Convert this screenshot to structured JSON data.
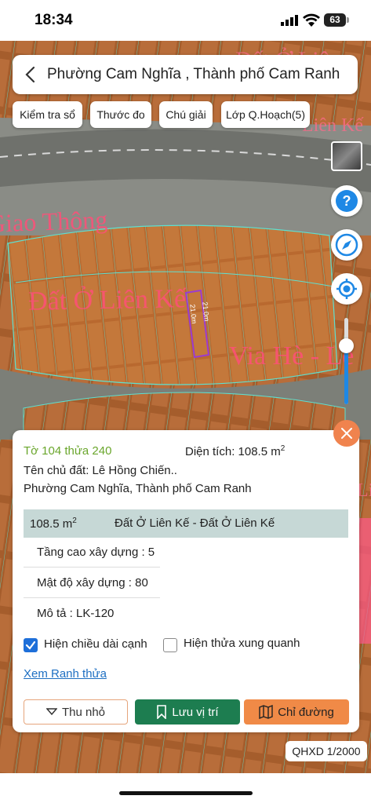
{
  "status": {
    "time": "18:34",
    "battery": "63"
  },
  "header": {
    "location": "Phường Cam Nghĩa , Thành phố Cam Ranh"
  },
  "toolbar": {
    "check_book": "Kiểm tra sổ",
    "ruler": "Thước đo",
    "legend": "Chú giải",
    "planning_layer": "Lớp Q.Hoạch(5)"
  },
  "map": {
    "labels": {
      "traffic": "Giao Thông",
      "residential": "Đất Ở Liên Kế",
      "sidewalk": "Via Hè - Lề",
      "top_repeat": "Đất Ở Liên",
      "chip_repeat": "Liên Kế",
      "edge_repeat": "Liên Kế"
    },
    "dim_long": "21.0m",
    "dim_short": "21.0m",
    "scale": "QHXD 1/2000"
  },
  "panel": {
    "parcel_id": "Tờ 104 thửa 240",
    "area_label": "Diện tích: 108.5 m",
    "area_sup": "2",
    "owner": "Tên chủ đất: Lê Hồng Chiến..",
    "address": "Phường Cam Nghĩa, Thành phố Cam Ranh",
    "zone_area": "108.5 m",
    "zone_area_sup": "2",
    "zone_type": "Đất Ở Liên Kế - Đất Ở Liên Kế",
    "height": "Tầng cao xây dựng : 5",
    "density": "Mật độ xây dựng : 80",
    "desc": "Mô tả : LK-120",
    "show_edges": "Hiện chiều dài cạnh",
    "show_edges_checked": true,
    "show_neighbors": "Hiện thửa xung quanh",
    "show_neighbors_checked": false,
    "view_boundary": "Xem Ranh thửa",
    "btn_minimize": "Thu nhỏ",
    "btn_save": "Lưu vị trí",
    "btn_directions": "Chỉ đường"
  },
  "colors": {
    "accent_green": "#1d7d50",
    "accent_orange": "#f08a47",
    "link": "#1e6fc2",
    "check_blue": "#1e6fd9",
    "parcel_green": "#6aa62c"
  }
}
